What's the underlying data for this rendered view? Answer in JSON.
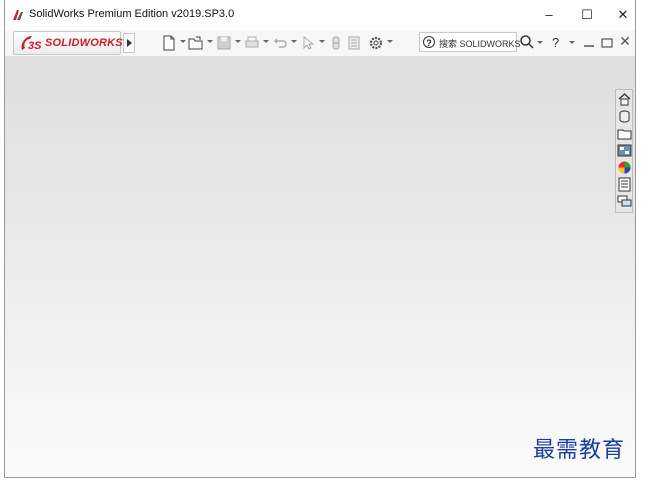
{
  "window": {
    "title": "SolidWorks Premium Edition v2019.SP3.0",
    "controls": {
      "minimize": "–",
      "maximize": "☐",
      "close": "✕"
    }
  },
  "toolbar": {
    "logo_text": "SOLIDWORKS",
    "logo_prefix": "3S",
    "icons": [
      "new-document-icon",
      "open-icon",
      "save-icon",
      "print-icon",
      "undo-icon",
      "select-icon",
      "rebuild-icon",
      "file-properties-icon",
      "options-gear-icon"
    ],
    "search": {
      "placeholder": "搜索 SOLIDWORKS",
      "help_glyph": "?"
    },
    "help_label": "?",
    "doc_controls": {
      "minimize": "–",
      "restore": "☐",
      "close": "✕"
    }
  },
  "task_pane": {
    "icons": [
      "home-icon",
      "parts-library-icon",
      "file-explorer-icon",
      "view-palette-icon",
      "appearances-icon",
      "custom-properties-icon",
      "forum-icon"
    ]
  },
  "watermark": "最需教育",
  "colors": {
    "brand_red": "#c8202f",
    "watermark_blue": "#1a3ea0"
  }
}
